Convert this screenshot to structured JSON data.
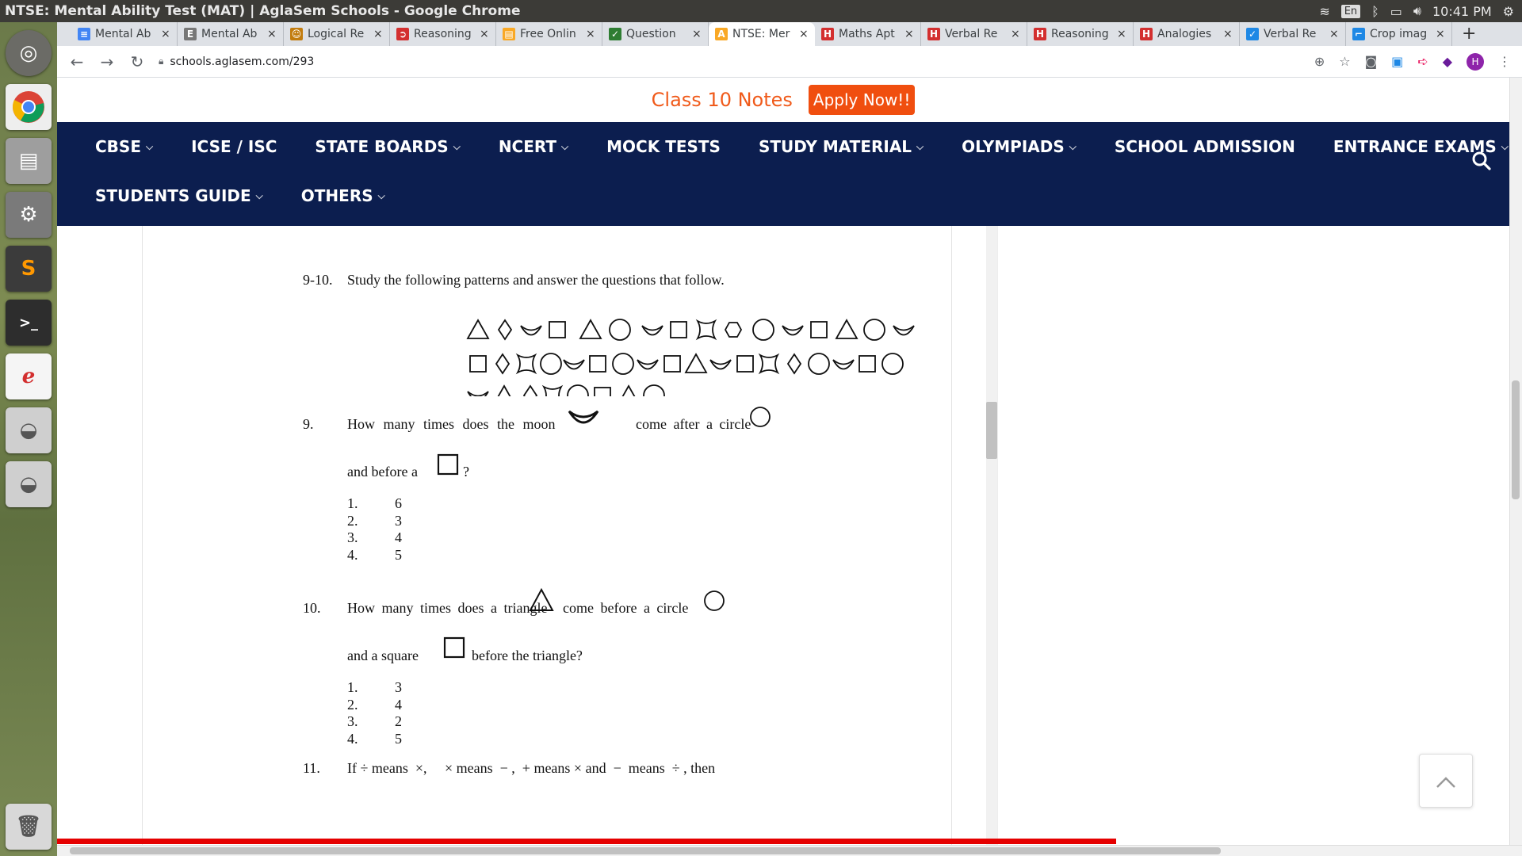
{
  "window": {
    "title": "NTSE: Mental Ability Test (MAT) | AglaSem Schools - Google Chrome",
    "tray": {
      "keyboard": "En",
      "time": "10:41 PM"
    }
  },
  "tabs": [
    {
      "label": "Mental Ab",
      "favicon": "docs-icon",
      "color": "#4285f4",
      "glyph": "≡"
    },
    {
      "label": "Mental Ab",
      "favicon": "e-icon",
      "color": "#777",
      "glyph": "E"
    },
    {
      "label": "Logical Re",
      "favicon": "logo-icon",
      "color": "#c27c0e",
      "glyph": "☺"
    },
    {
      "label": "Reasoning",
      "favicon": "red-icon",
      "color": "#d32f2f",
      "glyph": "➲"
    },
    {
      "label": "Free Onlin",
      "favicon": "book-icon",
      "color": "#f9a825",
      "glyph": "▤"
    },
    {
      "label": "Question",
      "favicon": "check-icon",
      "color": "#2e7d32",
      "glyph": "✓"
    },
    {
      "label": "NTSE: Mer",
      "favicon": "aglasem-icon",
      "color": "#f9a825",
      "glyph": "A",
      "active": true
    },
    {
      "label": "Maths Apt",
      "favicon": "h-icon",
      "color": "#d32f2f",
      "glyph": "H"
    },
    {
      "label": "Verbal Re",
      "favicon": "h-icon",
      "color": "#d32f2f",
      "glyph": "H"
    },
    {
      "label": "Reasoning",
      "favicon": "h-icon",
      "color": "#d32f2f",
      "glyph": "H"
    },
    {
      "label": "Analogies",
      "favicon": "h-icon",
      "color": "#d32f2f",
      "glyph": "H"
    },
    {
      "label": "Verbal Re",
      "favicon": "check-icon",
      "color": "#1e88e5",
      "glyph": "✓"
    },
    {
      "label": "Crop imag",
      "favicon": "crop-icon",
      "color": "#1e88e5",
      "glyph": "⌐"
    }
  ],
  "toolbar": {
    "url": "schools.aglasem.com/293",
    "avatar": "H"
  },
  "promo": {
    "text": "Class 10 Notes",
    "button": "Apply Now!!"
  },
  "nav": {
    "row1": [
      {
        "label": "CBSE",
        "dropdown": true
      },
      {
        "label": "ICSE / ISC",
        "dropdown": false
      },
      {
        "label": "STATE BOARDS",
        "dropdown": true
      },
      {
        "label": "NCERT",
        "dropdown": true
      },
      {
        "label": "MOCK TESTS",
        "dropdown": false
      },
      {
        "label": "STUDY MATERIAL",
        "dropdown": true
      },
      {
        "label": "OLYMPIADS",
        "dropdown": true
      },
      {
        "label": "SCHOOL ADMISSION",
        "dropdown": false
      },
      {
        "label": "ENTRANCE EXAMS",
        "dropdown": true
      }
    ],
    "row2": [
      {
        "label": "STUDENTS GUIDE",
        "dropdown": true
      },
      {
        "label": "OTHERS",
        "dropdown": true
      }
    ]
  },
  "content": {
    "intro_num": "9-10.",
    "intro_text": "Study the following patterns and answer the questions that follow.",
    "pattern_rows": [
      [
        "triangle",
        "diamond",
        "moon",
        "square",
        "triangle",
        "circle",
        "moon",
        "square",
        "star",
        "hexagon",
        "circle",
        "moon",
        "square",
        "triangle",
        "circle",
        "moon"
      ],
      [
        "square",
        "diamond",
        "star",
        "circle",
        "moon",
        "square",
        "circle",
        "moon",
        "square",
        "triangle",
        "moon",
        "square",
        "star",
        "diamond",
        "circle",
        "moon",
        "square",
        "circle"
      ],
      [
        "moon",
        "triangle",
        "diamond",
        "star",
        "circle",
        "square",
        "triangle",
        "circle"
      ]
    ],
    "q9": {
      "num": "9.",
      "part1": "How many times does the moon",
      "part2": "come after a circle",
      "part3": "and before a",
      "part4": "?",
      "options": [
        {
          "n": "1.",
          "v": "6"
        },
        {
          "n": "2.",
          "v": "3"
        },
        {
          "n": "3.",
          "v": "4"
        },
        {
          "n": "4.",
          "v": "5"
        }
      ]
    },
    "q10": {
      "num": "10.",
      "part1": "How many times does a triangle",
      "part2": "come before a circle",
      "part3": "and a square",
      "part4": "before the triangle?",
      "options": [
        {
          "n": "1.",
          "v": "3"
        },
        {
          "n": "2.",
          "v": "4"
        },
        {
          "n": "3.",
          "v": "2"
        },
        {
          "n": "4.",
          "v": "5"
        }
      ]
    },
    "q11": {
      "num": "11.",
      "text": "If ÷ means  ×,     × means  − ,  + means × and  −  means  ÷ , then"
    }
  }
}
